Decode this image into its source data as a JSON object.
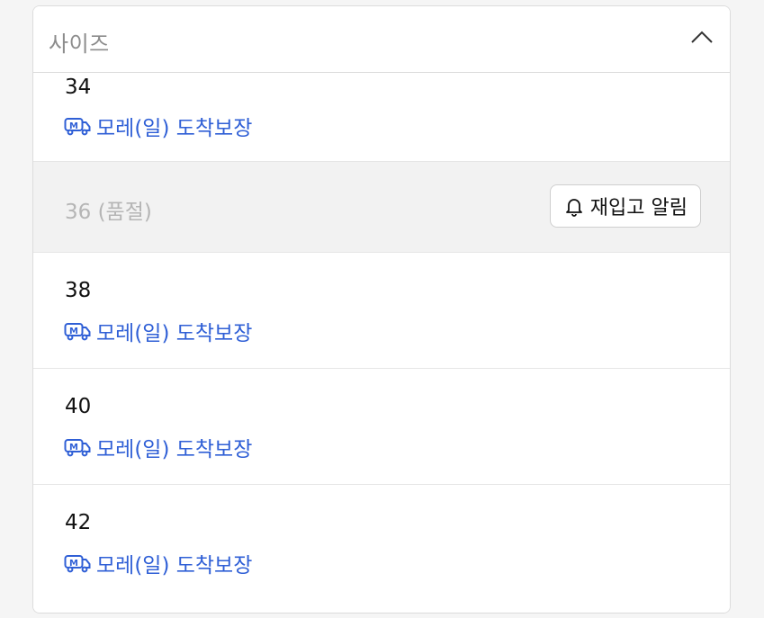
{
  "dropdown": {
    "label": "사이즈"
  },
  "options": [
    {
      "size": "34",
      "delivery": "모레(일) 도착보장"
    },
    {
      "size": "36 (품절)",
      "notify_label": "재입고 알림"
    },
    {
      "size": "38",
      "delivery": "모레(일) 도착보장"
    },
    {
      "size": "40",
      "delivery": "모레(일) 도착보장"
    },
    {
      "size": "42",
      "delivery": "모레(일) 도착보장"
    }
  ],
  "icons": {
    "chevron": "chevron-up-icon",
    "truck": "delivery-truck-icon",
    "bell": "bell-icon"
  },
  "colors": {
    "delivery_text": "#2f5fd6",
    "soldout_bg": "#f2f2f2"
  }
}
